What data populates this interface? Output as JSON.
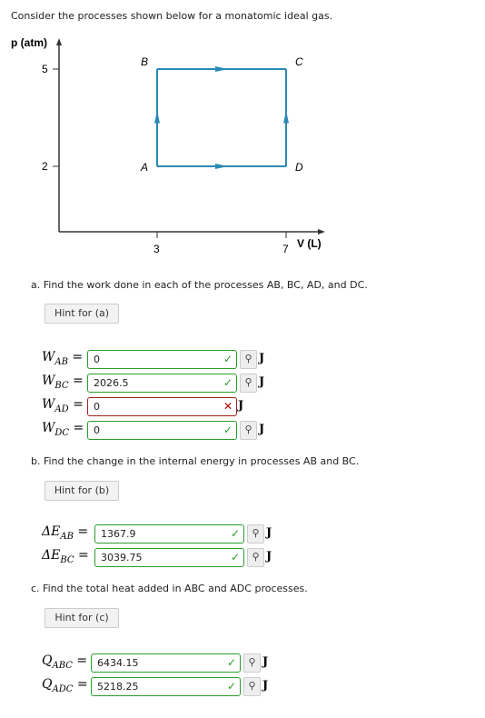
{
  "intro": "Consider the processes shown below for a monatomic ideal gas.",
  "chart_data": {
    "type": "line",
    "ylabel": "p (atm)",
    "xlabel": "V (L)",
    "yticks": [
      "5",
      "2"
    ],
    "xticks": [
      "3",
      "7"
    ],
    "points": [
      {
        "label": "A",
        "V": 3,
        "p": 2
      },
      {
        "label": "B",
        "V": 3,
        "p": 5
      },
      {
        "label": "C",
        "V": 7,
        "p": 5
      },
      {
        "label": "D",
        "V": 7,
        "p": 2
      }
    ],
    "paths": [
      "A→B",
      "B→C",
      "A→D",
      "D→C"
    ],
    "line_color": "#2a8ab4"
  },
  "parts": [
    {
      "question": "a. Find the work done in each of the processes AB, BC, AD, and DC.",
      "hint": "Hint for (a)",
      "rows": [
        {
          "sym": "W",
          "sub": "AB",
          "value": "0",
          "status": "correct",
          "unit": "J"
        },
        {
          "sym": "W",
          "sub": "BC",
          "value": "2026.5",
          "status": "correct",
          "unit": "J"
        },
        {
          "sym": "W",
          "sub": "AD",
          "value": "0",
          "status": "incorrect",
          "unit": "J"
        },
        {
          "sym": "W",
          "sub": "DC",
          "value": "0",
          "status": "correct",
          "unit": "J"
        }
      ]
    },
    {
      "question": "b. Find the change in the internal energy in processes AB and BC.",
      "hint": "Hint for (b)",
      "rows": [
        {
          "sym": "ΔE",
          "sub": "AB",
          "value": "1367.9",
          "status": "correct",
          "unit": "J"
        },
        {
          "sym": "ΔE",
          "sub": "BC",
          "value": "3039.75",
          "status": "correct",
          "unit": "J"
        }
      ]
    },
    {
      "question": "c. Find the total heat added in ABC and ADC processes.",
      "hint": "Hint for (c)",
      "rows": [
        {
          "sym": "Q",
          "sub": "ABC",
          "value": "6434.15",
          "status": "correct",
          "unit": "J"
        },
        {
          "sym": "Q",
          "sub": "ADC",
          "value": "5218.25",
          "status": "correct",
          "unit": "J"
        }
      ]
    }
  ]
}
